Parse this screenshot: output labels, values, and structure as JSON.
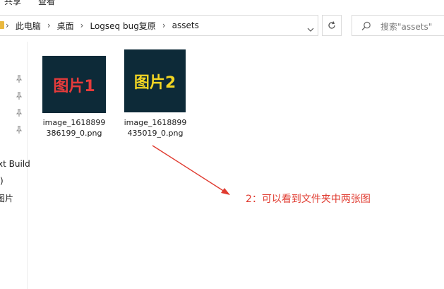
{
  "ribbon": {
    "tabs": [
      "共享",
      "查看"
    ]
  },
  "address_bar": {
    "folder_icon": "folder-icon",
    "breadcrumbs": [
      "此电脑",
      "桌面",
      "Logseq bug复原",
      "assets"
    ],
    "dropdown_icon": "chevron-down-icon",
    "refresh_icon": "refresh-icon"
  },
  "search": {
    "placeholder": "搜索\"assets\"",
    "icon": "search-icon"
  },
  "nav_pane": {
    "pin_icon": "pin-icon",
    "pinned_count": 4,
    "items": [
      "xt Build",
      ")",
      "图片"
    ]
  },
  "files": [
    {
      "thumb_text": "图片1",
      "thumb_color": "#e63b3b",
      "name": "image_1618899386199_0.png",
      "name_lines": [
        "image_1618899",
        "386199_0.png"
      ]
    },
    {
      "thumb_text": "图片2",
      "thumb_color": "#f2d523",
      "name": "image_1618899435019_0.png",
      "name_lines": [
        "image_1618899",
        "435019_0.png"
      ]
    }
  ],
  "annotation": {
    "text": "2：可以看到文件夹中两张图",
    "color": "#e03a2f"
  },
  "colors": {
    "thumb_bg": "#0d2a38",
    "folder": "#e9b83f",
    "border": "#d9d9d9"
  }
}
